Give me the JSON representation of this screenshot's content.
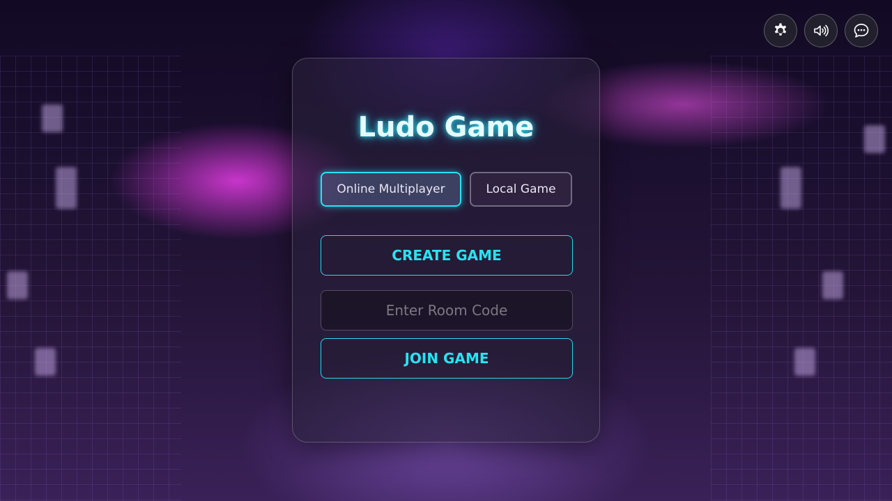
{
  "title": "Ludo Game",
  "modes": {
    "online_label": "Online Multiplayer",
    "local_label": "Local Game",
    "selected": "Online Multiplayer"
  },
  "actions": {
    "create_label": "CREATE GAME",
    "join_label": "JOIN GAME"
  },
  "room_code": {
    "value": "",
    "placeholder": "Enter Room Code"
  },
  "top_controls": [
    {
      "icon": "gear-icon"
    },
    {
      "icon": "speaker-icon"
    },
    {
      "icon": "chat-icon"
    }
  ],
  "colors": {
    "accent": "#27e4f2",
    "title_glow": "#27d9ee",
    "background_magenta": "#e63ce6"
  }
}
